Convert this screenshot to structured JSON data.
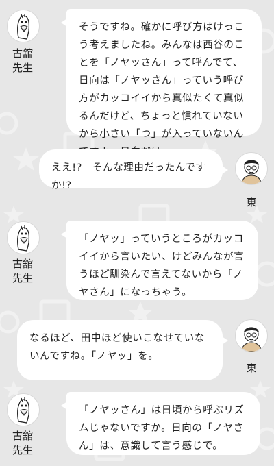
{
  "colors": {
    "background": "#e7e7e7",
    "bubble": "#ffffff",
    "text": "#222222"
  },
  "messages": [
    {
      "speaker": "古舘\n先生",
      "side": "left",
      "avatar_icon": "bird-mascot-icon",
      "text": "そうですね。確かに呼び方はけっこう考えましたね。みんなは西谷のことを「ノヤッさん」って呼んでて、日向は「ノヤッさん」っていう呼び方がカッコイイから真似たくて真似るんだけど、ちょっと慣れていないから小さい「つ」が入っていないんですよ。日向だけ。"
    },
    {
      "speaker": "東",
      "side": "right",
      "avatar_icon": "man-glasses-icon",
      "text": "ええ!?　そんな理由だったんですか!?"
    },
    {
      "speaker": "古舘\n先生",
      "side": "left",
      "avatar_icon": "bird-mascot-icon",
      "text": "「ノヤッ」っていうところがカッコイイから言いたい、けどみんなが言うほど馴染んで言えてないから「ノヤさん」になっちゃう。"
    },
    {
      "speaker": "東",
      "side": "right",
      "avatar_icon": "man-glasses-icon",
      "text": "なるほど、田中ほど使いこなせていないんですね。「ノヤッ」を。"
    },
    {
      "speaker": "古舘\n先生",
      "side": "left",
      "avatar_icon": "bird-mascot-icon",
      "text": "「ノヤッさん」は日頃から呼ぶリズムじゃないですか。日向の「ノヤさん」は、意識して言う感じで。"
    }
  ]
}
